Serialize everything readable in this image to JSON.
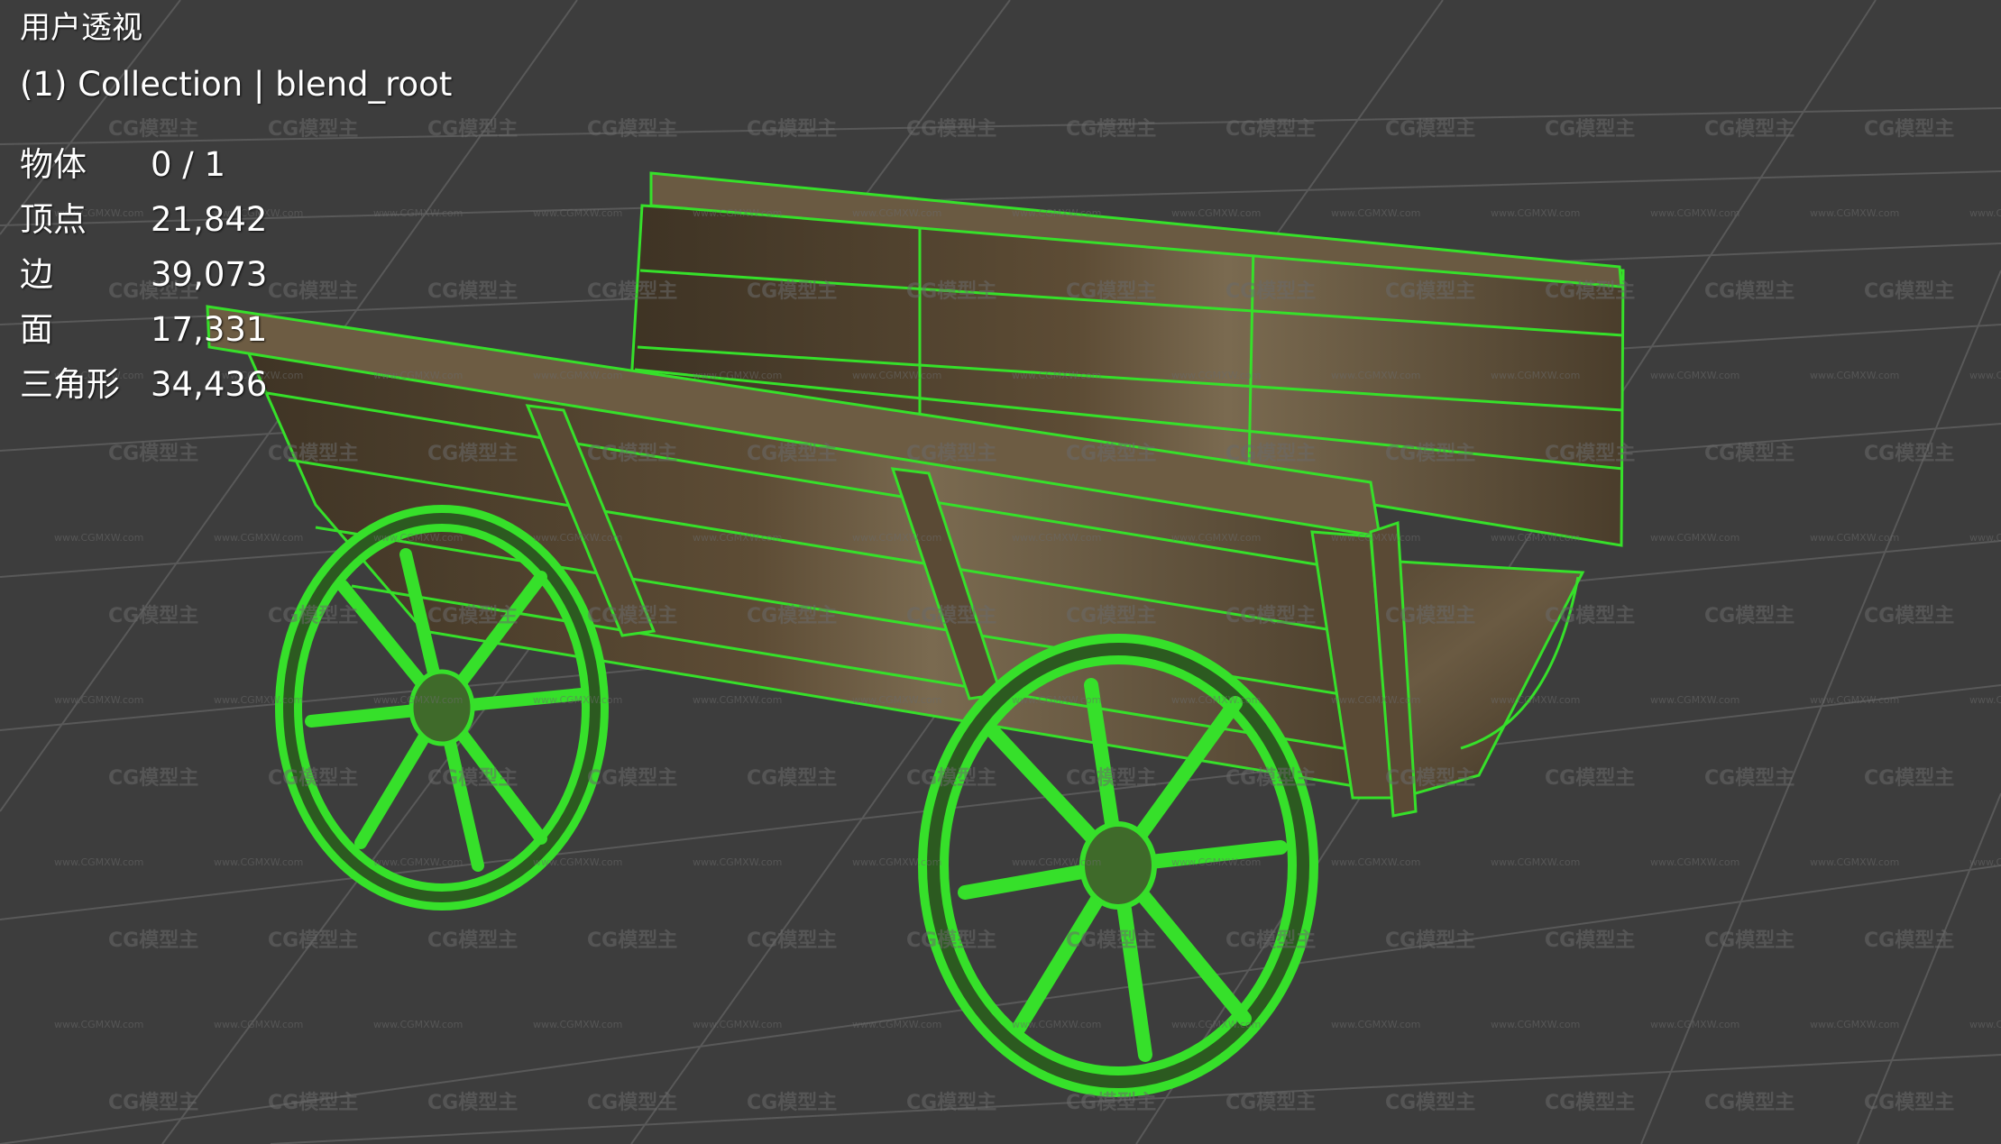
{
  "viewport": {
    "view_name": "用户透视",
    "collection_info": "(1) Collection | blend_root"
  },
  "statistics": [
    {
      "label": "物体",
      "value": "0 / 1"
    },
    {
      "label": "顶点",
      "value": "21,842"
    },
    {
      "label": "边",
      "value": "39,073"
    },
    {
      "label": "面",
      "value": "17,331"
    },
    {
      "label": "三角形",
      "value": "34,436"
    }
  ],
  "watermark": {
    "logo_text": "CG模型主",
    "url_text": "www.CGMXW.com"
  },
  "colors": {
    "background": "#3d3d3d",
    "grid_line": "#5a5a5a",
    "wireframe": "#36e02a",
    "wood_dark": "#3e3324",
    "wood_mid": "#5d4c35",
    "wood_light": "#8a7a5c"
  }
}
